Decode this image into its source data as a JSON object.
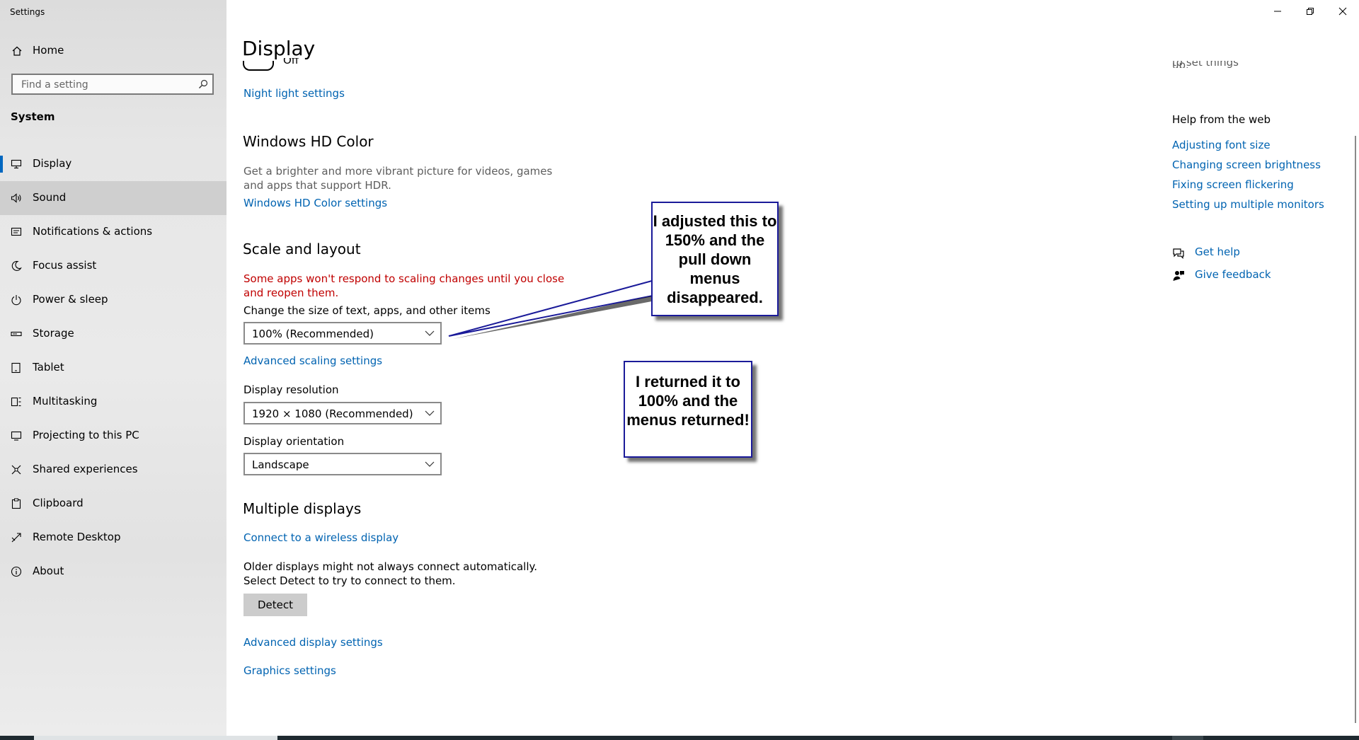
{
  "window": {
    "title": "Settings",
    "minimize_icon": "minimize-icon",
    "restore_icon": "restore-icon",
    "close_icon": "close-icon"
  },
  "sidebar": {
    "home": {
      "label": "Home",
      "icon": "home-icon"
    },
    "search": {
      "placeholder": "Find a setting",
      "value": "",
      "icon": "search-icon"
    },
    "section_label": "System",
    "items": [
      {
        "label": "Display",
        "icon": "monitor-icon",
        "selected": true
      },
      {
        "label": "Sound",
        "icon": "speaker-icon",
        "hover": true
      },
      {
        "label": "Notifications & actions",
        "icon": "notification-icon"
      },
      {
        "label": "Focus assist",
        "icon": "moon-icon"
      },
      {
        "label": "Power & sleep",
        "icon": "power-icon"
      },
      {
        "label": "Storage",
        "icon": "storage-icon"
      },
      {
        "label": "Tablet",
        "icon": "tablet-icon"
      },
      {
        "label": "Multitasking",
        "icon": "multitasking-icon"
      },
      {
        "label": "Projecting to this PC",
        "icon": "projecting-icon"
      },
      {
        "label": "Shared experiences",
        "icon": "shared-experiences-icon"
      },
      {
        "label": "Clipboard",
        "icon": "clipboard-icon"
      },
      {
        "label": "Remote Desktop",
        "icon": "remote-desktop-icon"
      },
      {
        "label": "About",
        "icon": "info-icon"
      }
    ]
  },
  "main": {
    "page_title": "Display",
    "toggle_partial_text": "Off",
    "night_light_link": "Night light settings",
    "hd_color": {
      "heading": "Windows HD Color",
      "description": "Get a brighter and more vibrant picture for videos, games and apps that support HDR.",
      "link": "Windows HD Color settings"
    },
    "scale_layout": {
      "heading": "Scale and layout",
      "warning": "Some apps won't respond to scaling changes until you close and reopen them.",
      "size_label": "Change the size of text, apps, and other items",
      "size_value": "100% (Recommended)",
      "advanced_link": "Advanced scaling settings",
      "resolution_label": "Display resolution",
      "resolution_value": "1920 × 1080 (Recommended)",
      "orientation_label": "Display orientation",
      "orientation_value": "Landscape"
    },
    "multiple_displays": {
      "heading": "Multiple displays",
      "wireless_link": "Connect to a wireless display",
      "description": "Older displays might not always connect automatically. Select Detect to try to connect to them.",
      "detect_button": "Detect",
      "advanced_display_link": "Advanced display settings",
      "graphics_link": "Graphics settings"
    }
  },
  "right_rail": {
    "partial_text": "to set things up.",
    "help_heading": "Help from the web",
    "help_links": [
      "Adjusting font size",
      "Changing screen brightness",
      "Fixing screen flickering",
      "Setting up multiple monitors"
    ],
    "get_help": {
      "label": "Get help",
      "icon": "get-help-icon"
    },
    "give_feedback": {
      "label": "Give feedback",
      "icon": "feedback-icon"
    }
  },
  "callouts": [
    {
      "text": "I adjusted this to 150% and the pull down menus disappeared."
    },
    {
      "text": "I returned it to 100% and the menus returned!"
    }
  ],
  "colors": {
    "accent": "#0067c0",
    "link": "#0063b1",
    "warning": "#c00000",
    "callout_border": "#1a1a99"
  }
}
